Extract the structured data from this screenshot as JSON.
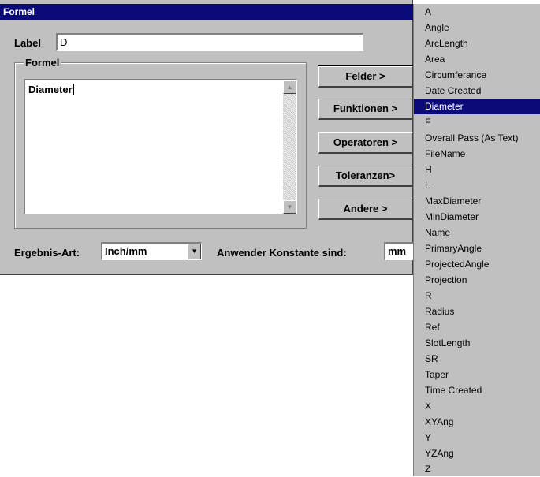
{
  "window": {
    "title": "Formel"
  },
  "label_field": {
    "label": "Label",
    "value": "D"
  },
  "formula_group": {
    "legend": "Formel",
    "text": "Diameter"
  },
  "buttons": [
    {
      "label": "Felder >"
    },
    {
      "label": "Funktionen >"
    },
    {
      "label": "Operatoren >"
    },
    {
      "label": "Toleranzen>"
    },
    {
      "label": "Andere >"
    }
  ],
  "result_type": {
    "label": "Ergebnis-Art:",
    "value": "Inch/mm"
  },
  "user_constants": {
    "label": "Anwender Konstante sind:",
    "value": "mm"
  },
  "fields_menu": {
    "selected": "Diameter",
    "items": [
      "A",
      "Angle",
      "ArcLength",
      "Area",
      "Circumferance",
      "Date Created",
      "Diameter",
      "F",
      "Overall Pass (As Text)",
      "FileName",
      "H",
      "L",
      "MaxDiameter",
      "MinDiameter",
      "Name",
      "PrimaryAngle",
      "ProjectedAngle",
      "Projection",
      "R",
      "Radius",
      "Ref",
      "SlotLength",
      "SR",
      "Taper",
      "Time Created",
      "X",
      "XYAng",
      "Y",
      "YZAng",
      "Z"
    ]
  },
  "colors": {
    "titlebar": "#0a0a78",
    "face": "#c0c0c0",
    "selection": "#0a0a78"
  }
}
